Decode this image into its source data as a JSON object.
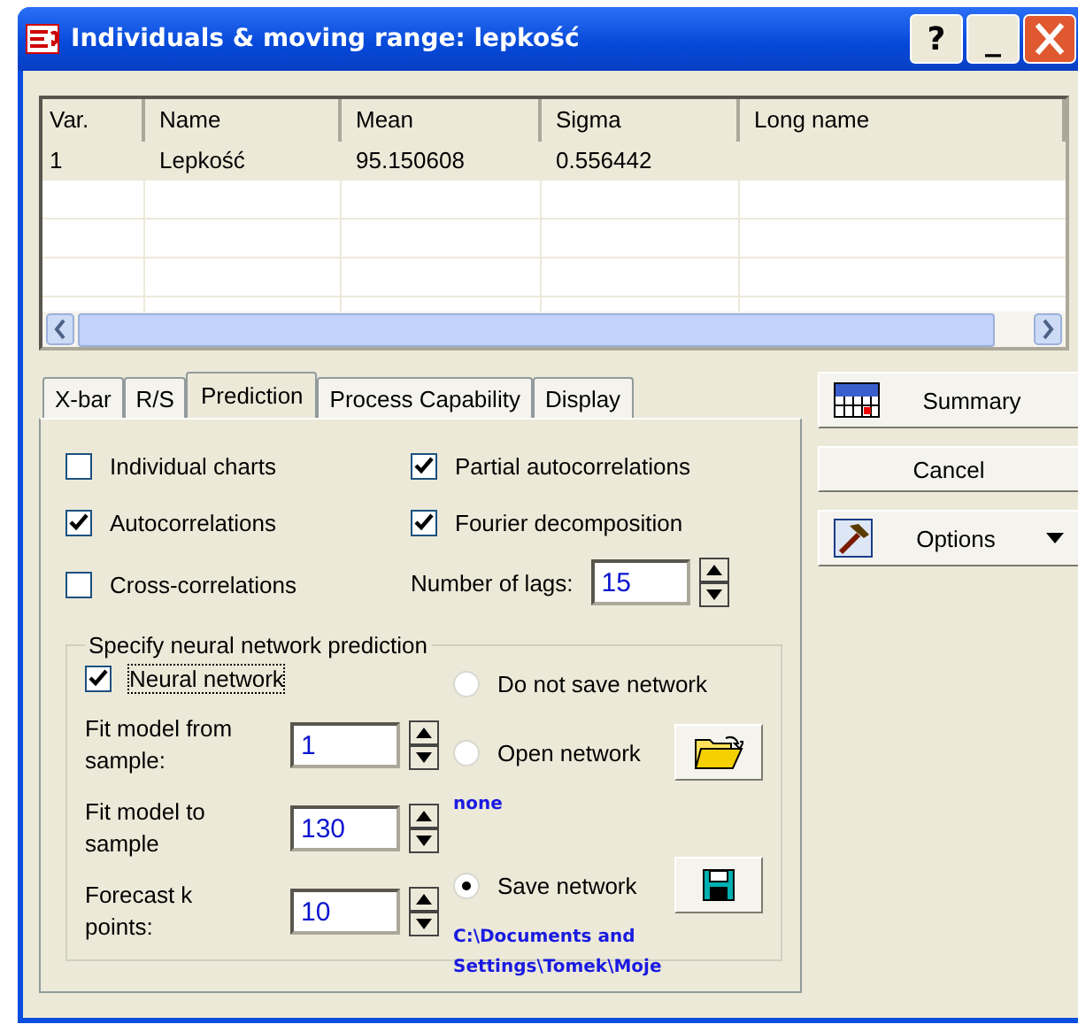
{
  "window": {
    "title": "Individuals & moving range: lepkość",
    "title_buttons": [
      "?",
      "_"
    ]
  },
  "table": {
    "columns": [
      "Var.",
      "Name",
      "Mean",
      "Sigma",
      "Long name"
    ],
    "rows": [
      {
        "cells": [
          "1",
          "Lepkość",
          "95.150608",
          "0.556442",
          ""
        ],
        "selected": true
      }
    ]
  },
  "tabs": [
    {
      "label": "X-bar",
      "selected": false
    },
    {
      "label": "R/S",
      "selected": false
    },
    {
      "label": "Prediction",
      "selected": true
    },
    {
      "label": "Process Capability",
      "selected": false
    },
    {
      "label": "Display",
      "selected": false
    }
  ],
  "options": [
    {
      "label": "Individual charts",
      "checked": false
    },
    {
      "label": "Partial autocorrelations",
      "checked": true
    },
    {
      "label": "Autocorrelations",
      "checked": true
    },
    {
      "label": "Fourier decomposition",
      "checked": true
    },
    {
      "label": "Cross-correlations",
      "checked": false
    }
  ],
  "lags": {
    "label": "Number of lags:",
    "value": "15"
  },
  "neural": {
    "title": "Specify neural network prediction",
    "checkbox": {
      "label": "Neural network",
      "checked": true
    },
    "fields": [
      {
        "label": "Fit model from sample:",
        "value": "1"
      },
      {
        "label": "Fit model to sample",
        "value": "130"
      },
      {
        "label": "Forecast k points:",
        "value": "10"
      }
    ],
    "radios": [
      {
        "label": "Do not save network",
        "selected": false
      },
      {
        "label": "Open network",
        "selected": false
      },
      {
        "label": "Save network",
        "selected": true
      }
    ],
    "open_path": "none",
    "save_path": [
      "C:\\Documents and",
      "Settings\\Tomek\\Moje"
    ]
  },
  "buttons": [
    {
      "label": "Summary",
      "kind": "summary"
    },
    {
      "label": "Cancel",
      "kind": "plain"
    },
    {
      "label": "Options",
      "kind": "menu"
    }
  ]
}
